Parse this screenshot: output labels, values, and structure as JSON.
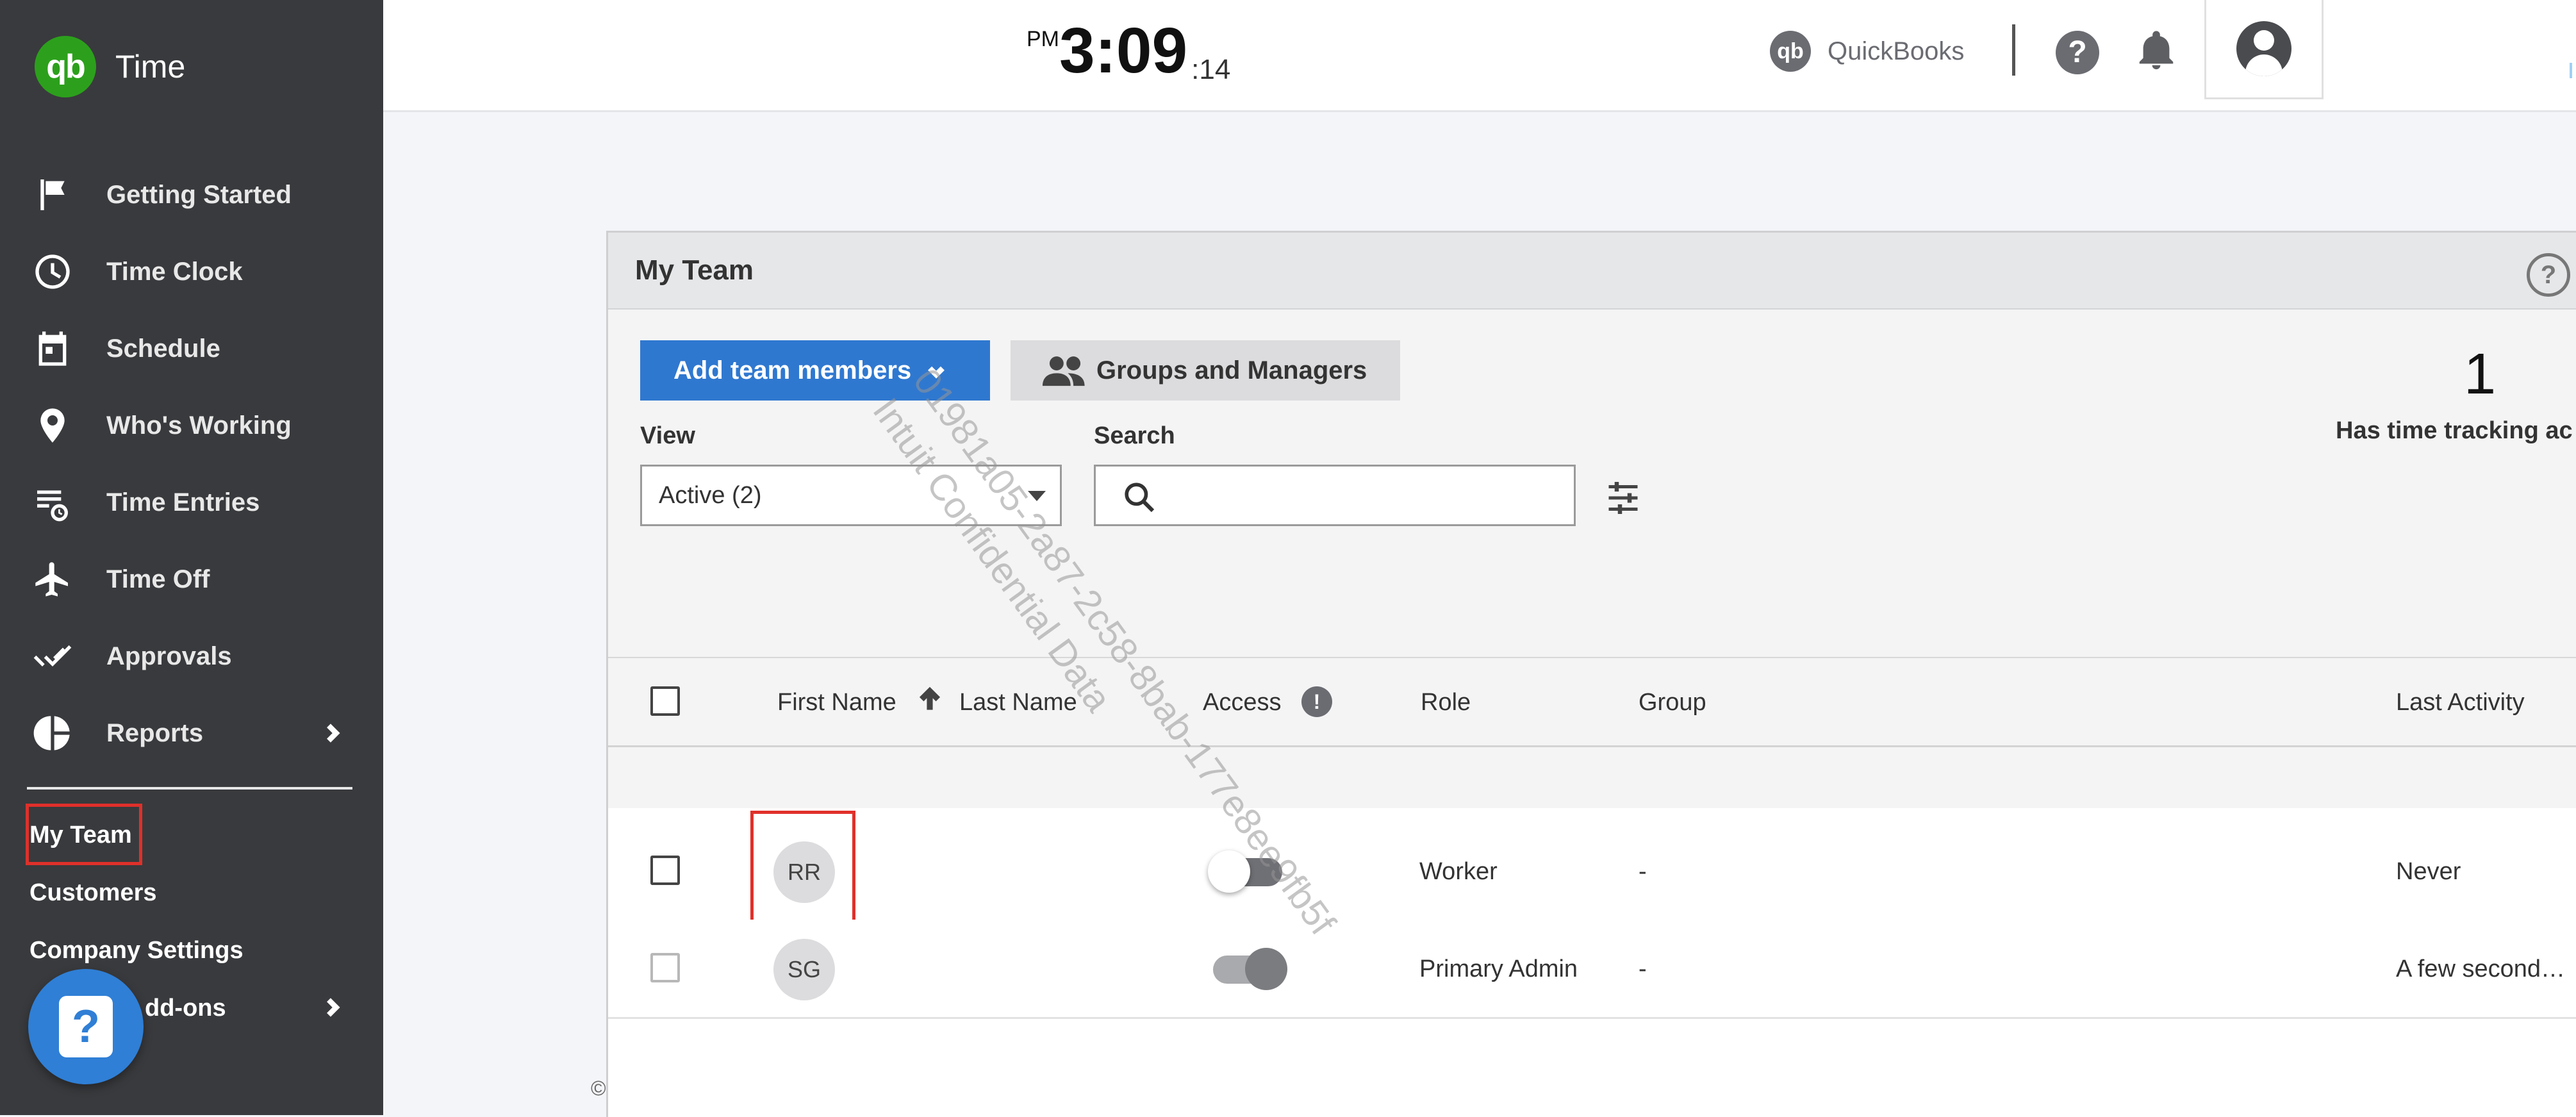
{
  "app": {
    "brand_logo": "qb",
    "brand_name": "Time"
  },
  "clock": {
    "ampm": "PM",
    "time": "3:09",
    "seconds": ":14"
  },
  "header": {
    "quickbooks_logo": "qb",
    "quickbooks_label": "QuickBooks",
    "help_glyph": "?"
  },
  "sidebar": {
    "items": [
      {
        "label": "Getting Started",
        "icon": "flag-icon"
      },
      {
        "label": "Time Clock",
        "icon": "clock-icon"
      },
      {
        "label": "Schedule",
        "icon": "calendar-icon"
      },
      {
        "label": "Who's Working",
        "icon": "location-pin-icon"
      },
      {
        "label": "Time Entries",
        "icon": "time-entries-icon"
      },
      {
        "label": "Time Off",
        "icon": "airplane-icon"
      },
      {
        "label": "Approvals",
        "icon": "double-check-icon"
      },
      {
        "label": "Reports",
        "icon": "pie-chart-icon"
      }
    ],
    "sub_items": [
      "My Team",
      "Customers",
      "Company Settings",
      "dd-ons"
    ],
    "help_glyph": "?"
  },
  "panel": {
    "title": "My Team",
    "help_glyph": "?",
    "add_button": "Add team members",
    "groups_button": "Groups and Managers",
    "view_label": "View",
    "view_value": "Active (2)",
    "search_label": "Search",
    "search_value": "",
    "stat_value": "1",
    "stat_label": "Has time tracking ac"
  },
  "table": {
    "columns": [
      "First Name",
      "Last Name",
      "Access",
      "Role",
      "Group",
      "Last Activity"
    ],
    "access_info_glyph": "!",
    "rows": [
      {
        "initials": "RR",
        "access": "off",
        "role": "Worker",
        "group": "-",
        "last_activity": "Never"
      },
      {
        "initials": "SG",
        "access": "on",
        "role": "Primary Admin",
        "group": "-",
        "last_activity": "A few second…"
      }
    ]
  },
  "watermark": {
    "line1": "01981a05-2a87-2c58-8bab-177e8ee9fb5f",
    "line2": "Intuit Confidential Data"
  },
  "footer": {
    "copyright": "©"
  },
  "colors": {
    "sidebar_bg": "#393a3d",
    "brand_green": "#2ca01c",
    "primary_blue": "#2f78d0",
    "highlight_red": "#e0302a"
  }
}
